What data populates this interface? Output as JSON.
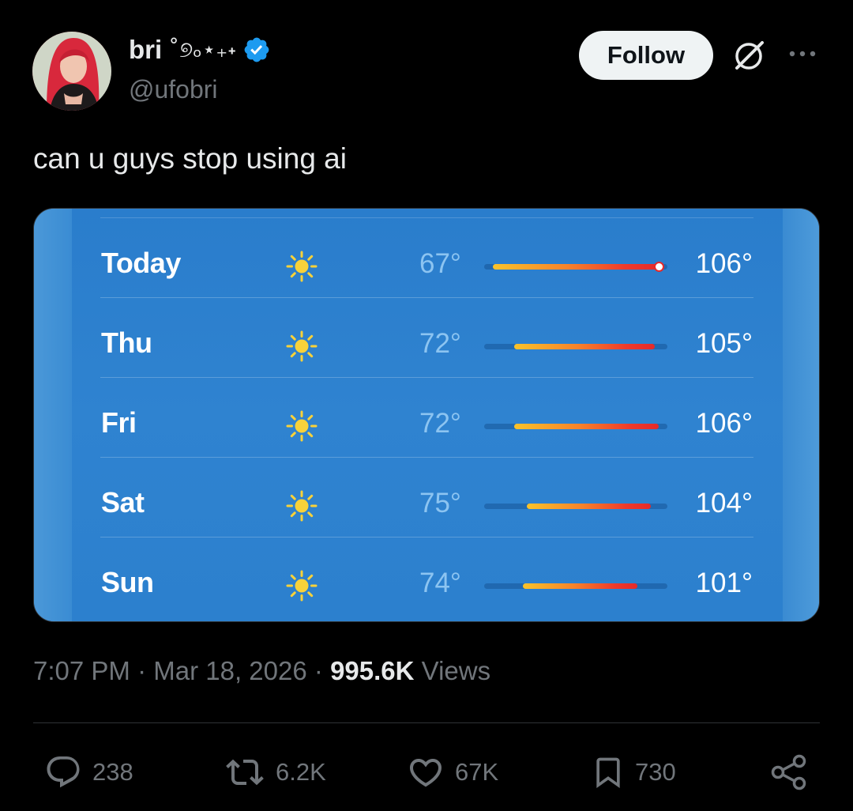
{
  "author": {
    "name": "bri",
    "name_deco": "˚୭ₒ⋆₊˖",
    "handle": "@ufobri",
    "verified": true
  },
  "header": {
    "follow_label": "Follow"
  },
  "tweet": {
    "text": "can u guys stop using ai"
  },
  "forecast": {
    "scale_min": 65,
    "scale_max": 108,
    "current_temp": 106,
    "days": [
      {
        "day": "Today",
        "icon": "sun-icon",
        "low": "67°",
        "high": "106°",
        "low_val": 67,
        "high_val": 106
      },
      {
        "day": "Thu",
        "icon": "sun-icon",
        "low": "72°",
        "high": "105°",
        "low_val": 72,
        "high_val": 105
      },
      {
        "day": "Fri",
        "icon": "sun-icon",
        "low": "72°",
        "high": "106°",
        "low_val": 72,
        "high_val": 106
      },
      {
        "day": "Sat",
        "icon": "sun-icon",
        "low": "75°",
        "high": "104°",
        "low_val": 75,
        "high_val": 104
      },
      {
        "day": "Sun",
        "icon": "sun-icon",
        "low": "74°",
        "high": "101°",
        "low_val": 74,
        "high_val": 101
      }
    ]
  },
  "meta": {
    "time": "7:07 PM",
    "sep": "·",
    "date": "Mar 18, 2026",
    "views_count": "995.6K",
    "views_label": "Views"
  },
  "actions": {
    "replies": "238",
    "reposts": "6.2K",
    "likes": "67K",
    "bookmarks": "730"
  },
  "colors": {
    "accent": "#1d9bf0",
    "background": "#000000",
    "text_primary": "#e7e9ea",
    "text_secondary": "#71767b"
  }
}
